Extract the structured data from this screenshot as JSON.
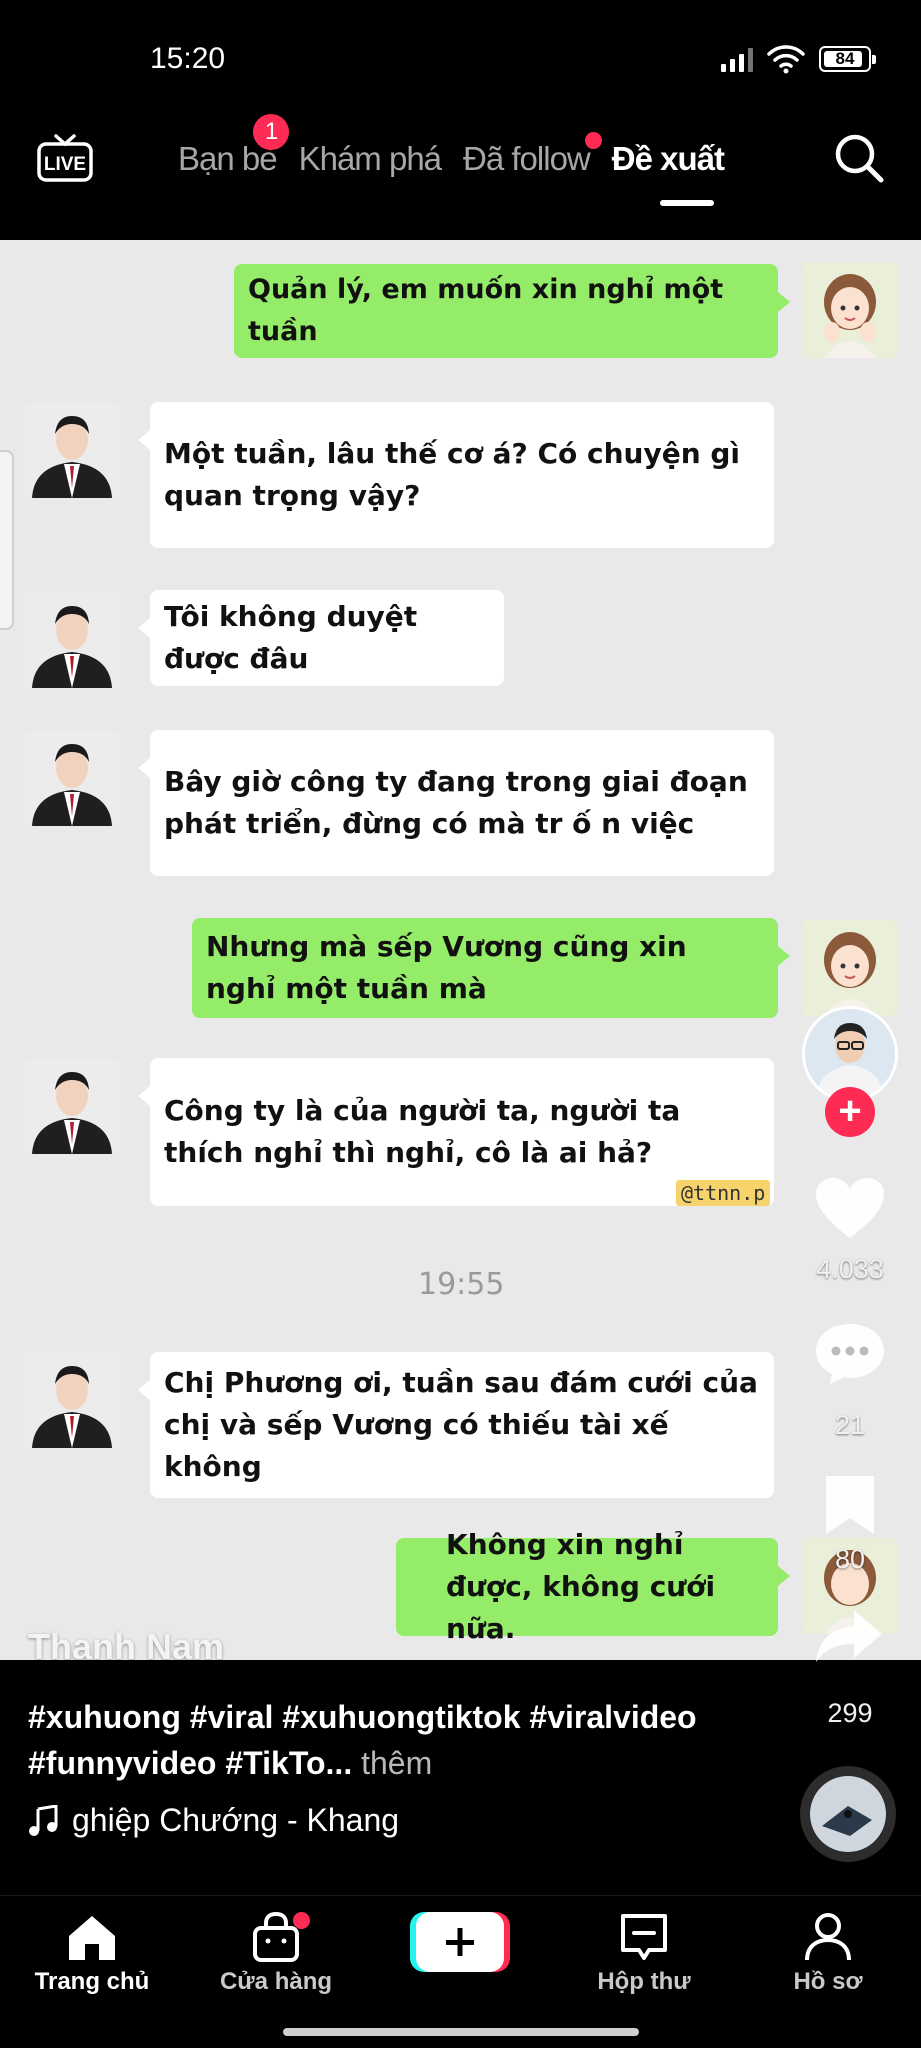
{
  "status": {
    "time": "15:20",
    "battery": "84"
  },
  "top_nav": {
    "live_label": "LIVE",
    "tabs": [
      {
        "label": "Bạn bè",
        "badge": "1"
      },
      {
        "label": "Khám phá"
      },
      {
        "label": "Đã follow"
      },
      {
        "label": "Đề xuất"
      }
    ]
  },
  "chat": {
    "messages": [
      {
        "side": "out",
        "text": "Quản lý, em muốn xin nghỉ một tuần"
      },
      {
        "side": "in",
        "text": "Một tuần, lâu thế cơ á? Có chuyện gì quan trọng vậy?"
      },
      {
        "side": "in",
        "text": "Tôi không duyệt được đâu"
      },
      {
        "side": "in",
        "text": "Bây giờ công ty đang trong giai đoạn phát triển, đừng có mà tr ố n việc"
      },
      {
        "side": "out",
        "text": "Nhưng mà sếp Vương cũng xin nghỉ một tuần mà"
      },
      {
        "side": "in",
        "text": "Công ty là của người ta, người ta thích nghỉ thì nghỉ, cô là ai hả?"
      },
      {
        "side": "in",
        "text": "Chị Phương ơi, tuần sau đám cưới của chị và sếp Vương có thiếu tài xế không"
      },
      {
        "side": "out",
        "text": "Không xin nghỉ được, không cưới nữa."
      }
    ],
    "timestamp": "19:55",
    "watermark": "@ttnn.p"
  },
  "video": {
    "author": "Thanh Nam",
    "caption": "#xuhuong #viral #xuhuongtiktok #viralvideo #funnyvideo #TikTo...",
    "caption_more": "thêm",
    "music": "ghiệp Chướng - Khang",
    "likes": "4.033",
    "comments": "21",
    "saves": "80",
    "shares": "299"
  },
  "bottom_nav": {
    "items": [
      "Trang chủ",
      "Cửa hàng",
      "Hộp thư",
      "Hồ sơ"
    ]
  },
  "colors": {
    "accent": "#fe2c55",
    "bubble_out": "#95ec69",
    "bubble_in": "#ffffff"
  }
}
